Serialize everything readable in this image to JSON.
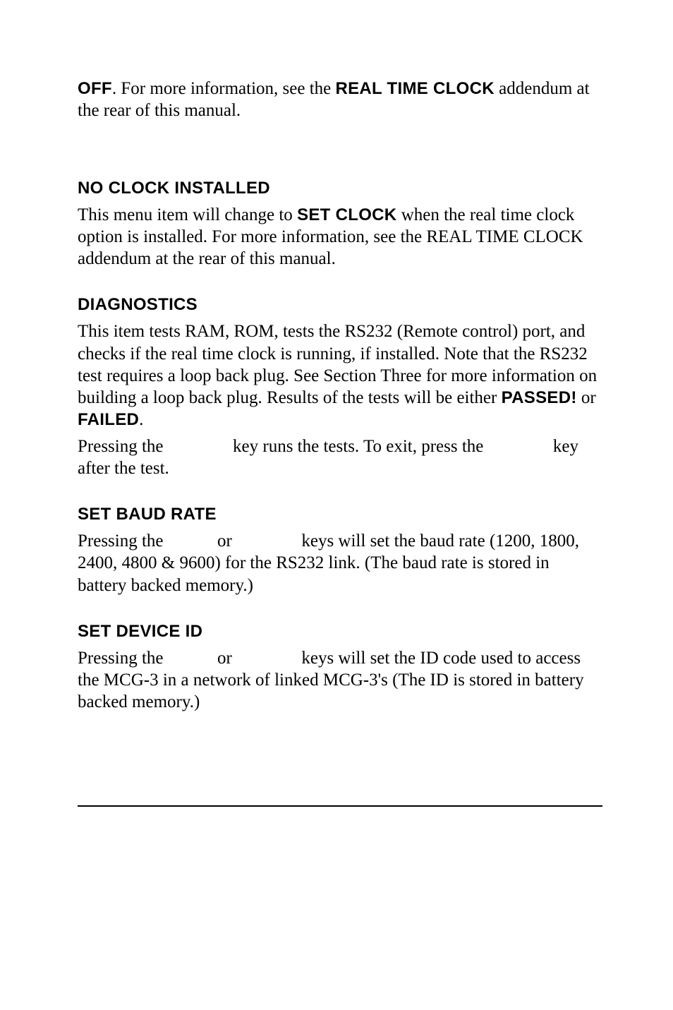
{
  "intro": {
    "off_label": "OFF",
    "text1": ". For more information, see the ",
    "rtc_label": "REAL TIME CLOCK",
    "text2": " addendum at the rear of this manual."
  },
  "no_clock": {
    "heading": "NO CLOCK INSTALLED",
    "text1": "This menu item will change to ",
    "set_clock_label": "SET CLOCK",
    "text2": " when the real time clock option is installed. For more information, see the REAL TIME CLOCK addendum at the rear of this manual."
  },
  "diagnostics": {
    "heading": "DIAGNOSTICS",
    "text1": "This item tests RAM, ROM, tests the RS232 (Remote control) port, and checks if the real time clock is running, if installed. Note that the RS232 test requires a loop back plug. See Section Three for more information on building a loop back plug. Results of the tests will be either ",
    "passed_label": "PASSED!",
    "or_text": " or ",
    "failed_label": "FAILED",
    "period": ".",
    "press1": "Pressing the ",
    "press2": " key runs the tests. To exit, press the ",
    "press3": " key after the test."
  },
  "baud": {
    "heading": "SET BAUD RATE",
    "press1": "Pressing the ",
    "or_text": " or ",
    "press2": " keys will set the baud rate (1200, 1800, 2400, 4800 & 9600) for the RS232 link. (The baud rate is stored in battery backed memory.)"
  },
  "device": {
    "heading": "SET DEVICE ID",
    "press1": "Pressing the ",
    "or_text": " or ",
    "press2": " keys will set the ID code used to access the MCG-3 in a network of linked MCG-3's (The ID is stored in battery backed memory.)"
  }
}
